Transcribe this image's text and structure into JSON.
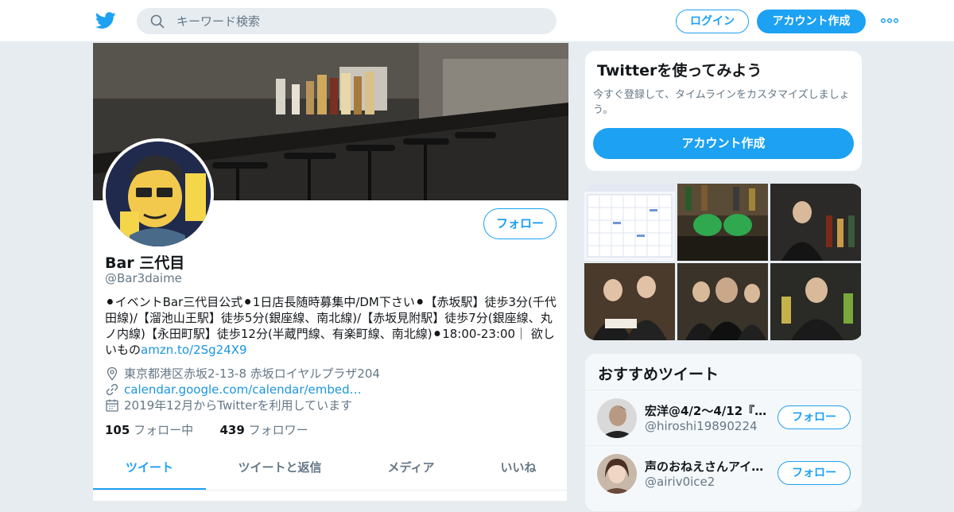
{
  "header": {
    "search_placeholder": "キーワード検索",
    "login_label": "ログイン",
    "signup_label": "アカウント作成",
    "brand_color": "#1da1f2"
  },
  "profile": {
    "name": "Bar 三代目",
    "handle": "@Bar3daime",
    "follow_label": "フォロー",
    "bio_text": "⚫イベントBar三代目公式⚫1日店長随時募集中/DM下さい⚫【赤坂駅】徒歩3分(千代田線)/【溜池山王駅】徒歩5分(銀座線、南北線)/【赤坂見附駅】徒歩7分(銀座線、丸ノ内線)【永田町駅】徒歩12分(半蔵門線、有楽町線、南北線)⚫18:00-23:00｜ 欲しいもの",
    "bio_link": "amzn.to/2Sg24X9",
    "location": "東京都港区赤坂2-13-8 赤坂ロイヤルプラザ204",
    "website": "calendar.google.com/calendar/embed…",
    "joined": "2019年12月からTwitterを利用しています",
    "following_count": "105",
    "following_label": "フォロー中",
    "followers_count": "439",
    "followers_label": "フォロワー",
    "tabs": [
      {
        "label": "ツイート"
      },
      {
        "label": "ツイートと返信"
      },
      {
        "label": "メディア"
      },
      {
        "label": "いいね"
      }
    ]
  },
  "sidebar": {
    "try_title": "Twitterを使ってみよう",
    "try_text": "今すぐ登録して、タイムラインをカスタマイズしましょう。",
    "try_button": "アカウント作成",
    "recommended_title": "おすすめツイート",
    "recommended": [
      {
        "name": "宏洋@4/2〜4/12『へ…",
        "handle": "@hiroshi19890224",
        "follow_label": "フォロー"
      },
      {
        "name": "声のおねえさんアイ…",
        "handle": "@airiv0ice2",
        "follow_label": "フォロー"
      }
    ]
  }
}
